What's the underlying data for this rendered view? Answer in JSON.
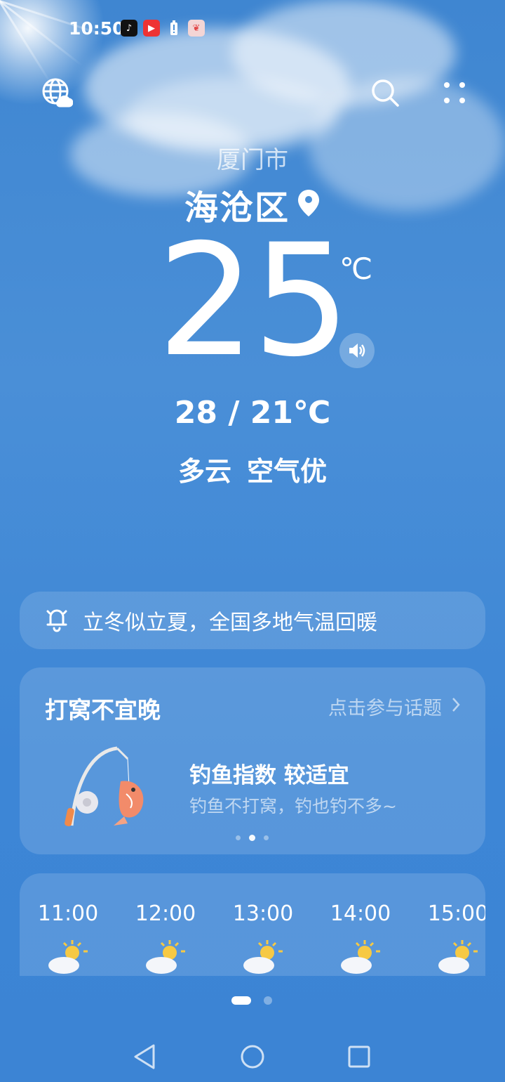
{
  "status_bar": {
    "time": "10:50",
    "icons": [
      "tiktok-icon",
      "video-app-icon",
      "battery-alert-icon",
      "app-icon"
    ]
  },
  "header": {
    "left_icon": "globe-cloud-icon",
    "right_icons": [
      "search-icon",
      "more-icon"
    ]
  },
  "location": {
    "city": "厦门市",
    "district": "海沧区"
  },
  "current": {
    "temperature": "25",
    "unit": "℃",
    "range": "28 / 21℃",
    "condition": "多云",
    "air_quality": "空气优"
  },
  "news": {
    "text": "立冬似立夏，全国多地气温回暖"
  },
  "topic": {
    "title": "打窝不宜晚",
    "link": "点击参与话题",
    "index_title": "钓鱼指数 较适宜",
    "index_desc": "钓鱼不打窝，钓也钓不多~"
  },
  "hourly": [
    {
      "time": "11:00",
      "icon": "partly-sunny-icon"
    },
    {
      "time": "12:00",
      "icon": "partly-sunny-icon"
    },
    {
      "time": "13:00",
      "icon": "partly-sunny-icon"
    },
    {
      "time": "14:00",
      "icon": "partly-sunny-icon"
    },
    {
      "time": "15:00",
      "icon": "partly-sunny-icon"
    }
  ],
  "colors": {
    "background": "#4a8fd7",
    "card": "rgba(255,255,255,0.14)",
    "sun": "#f6c944"
  }
}
